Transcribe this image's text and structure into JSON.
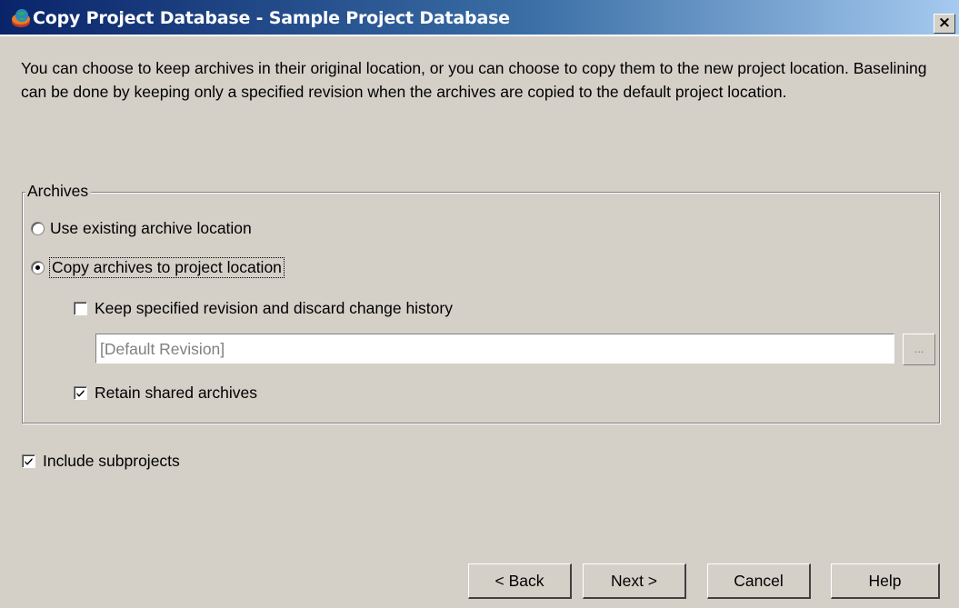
{
  "window": {
    "title": "Copy Project Database - Sample Project Database",
    "close_label": "×",
    "icon": "project-database-icon"
  },
  "intro_text": "You can choose to keep archives in their original location, or you can choose to copy them to the new project location.  Baselining can be done by keeping only a specified revision when the archives are copied to the default project location.",
  "archives": {
    "legend": "Archives",
    "options": [
      {
        "label": "Use existing archive location",
        "selected": false
      },
      {
        "label": "Copy archives to project location",
        "selected": true
      }
    ],
    "keep_revision": {
      "label": "Keep specified revision and discard change history",
      "checked": false
    },
    "revision_field": {
      "value": "[Default Revision]",
      "enabled": false
    },
    "browse_label": "...",
    "retain_shared": {
      "label": "Retain shared archives",
      "checked": true
    }
  },
  "include_subprojects": {
    "label": "Include subprojects",
    "checked": true
  },
  "buttons": {
    "back": "< Back",
    "next": "Next >",
    "cancel": "Cancel",
    "help": "Help"
  }
}
